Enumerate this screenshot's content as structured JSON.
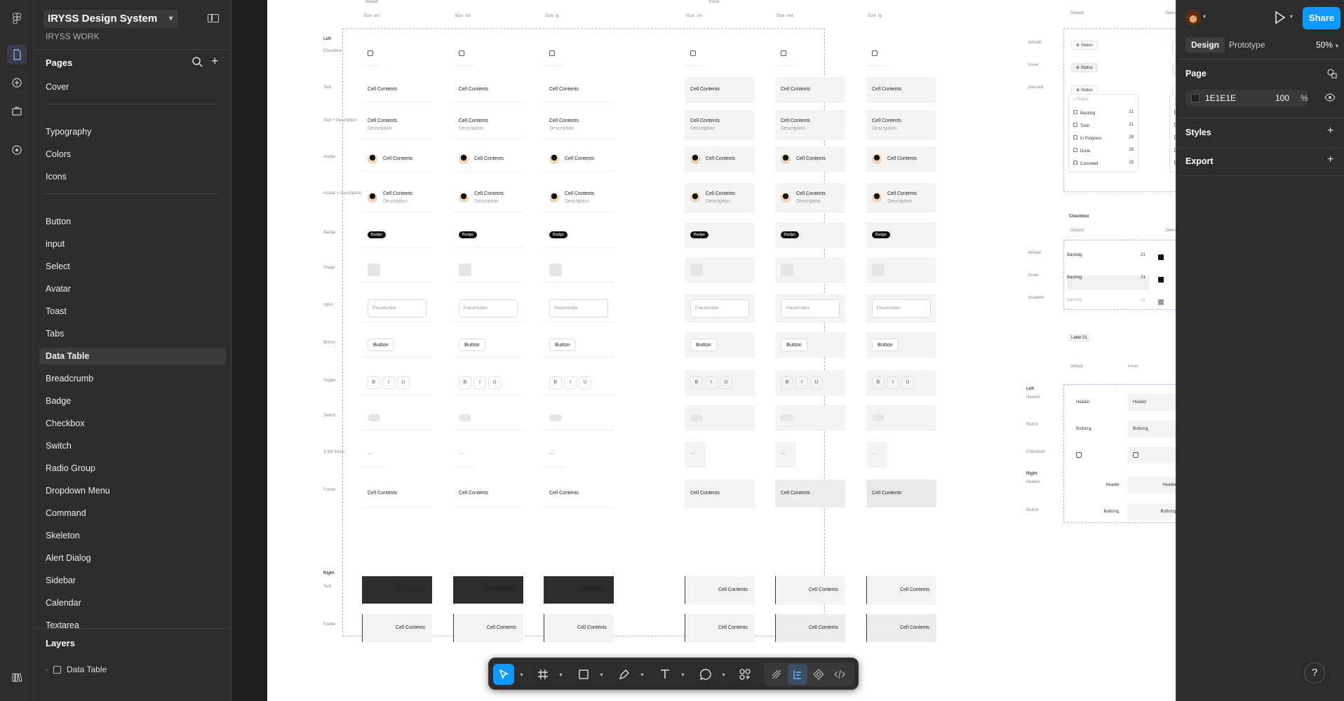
{
  "file": {
    "title": "IRYSS Design System",
    "team": "IRYSS WORK"
  },
  "pages": {
    "header": "Pages",
    "groups": [
      [
        "Cover"
      ],
      [
        "Typography",
        "Colors",
        "Icons"
      ],
      [
        "Button",
        "input",
        "Select",
        "Avatar",
        "Toast",
        "Tabs",
        "Data Table",
        "Breadcrumb",
        "Badge",
        "Checkbox",
        "Switch",
        "Radio Group",
        "Dropdown Menu",
        "Command",
        "Skeleton",
        "Alert Dialog",
        "Sidebar",
        "Calendar",
        "Textarea"
      ]
    ],
    "selected": "Data Table"
  },
  "layers": {
    "header": "Layers",
    "items": [
      {
        "label": "Data Table"
      }
    ]
  },
  "right_panel": {
    "tabs": [
      "Design",
      "Prototype"
    ],
    "zoom": "50%",
    "share": "Share",
    "page_section": "Page",
    "bg_hex": "1E1E1E",
    "bg_opacity": "100",
    "opacity_unit": "%",
    "styles": "Styles",
    "export": "Export",
    "help": "?"
  },
  "canvas": {
    "states": [
      "default",
      "hover"
    ],
    "sizes": [
      "Size: sm",
      "Size: md",
      "Size: lg",
      "Size: sm",
      "Size: md",
      "Size: lg"
    ],
    "left_label": "Left",
    "right_label": "Right",
    "rows": [
      {
        "label": "Checkbox",
        "type": "checkbox"
      },
      {
        "label": "Text",
        "type": "text"
      },
      {
        "label": "Text + Description",
        "type": "textdesc"
      },
      {
        "label": "Avatar",
        "type": "avatar"
      },
      {
        "label": "Avatar + Description",
        "type": "avatardesc"
      },
      {
        "label": "Badge",
        "type": "badge"
      },
      {
        "label": "Image",
        "type": "image"
      },
      {
        "label": "Input",
        "type": "input"
      },
      {
        "label": "Button",
        "type": "button"
      },
      {
        "label": "Toggle",
        "type": "toggle"
      },
      {
        "label": "Switch",
        "type": "switch"
      },
      {
        "label": "3-dot menu",
        "type": "menu"
      },
      {
        "label": "Footer",
        "type": "footer"
      }
    ],
    "right_rows": [
      {
        "label": "Text"
      },
      {
        "label": "Footer"
      }
    ],
    "cell_text": "Cell Contents",
    "desc_text": "Description",
    "badge_text": "Badge",
    "placeholder": "Placeholder",
    "button_text": "Button",
    "toggle": [
      "B",
      "I",
      "U"
    ],
    "dots": "···",
    "side": {
      "cols": [
        "Default",
        "Selected"
      ],
      "states": [
        "default",
        "hover",
        "pressed"
      ],
      "status": "Status",
      "options": [
        {
          "label": "Backlog",
          "count": "21"
        },
        {
          "label": "Todo",
          "count": "21"
        },
        {
          "label": "In Progress",
          "count": "28"
        },
        {
          "label": "Done",
          "count": "19"
        },
        {
          "label": "Canceled",
          "count": "19"
        }
      ],
      "checkbox_title": "Checkbox",
      "checkbox_states": [
        "default",
        "hover",
        "disabled"
      ],
      "label01": "Label 01",
      "header_cols": [
        "default",
        "hover"
      ],
      "header_rows": [
        "Left",
        "Header",
        "Button",
        "Checkbox",
        "Right",
        "Header",
        "Button"
      ],
      "header_text": "Header",
      "button_text": "Button"
    }
  }
}
